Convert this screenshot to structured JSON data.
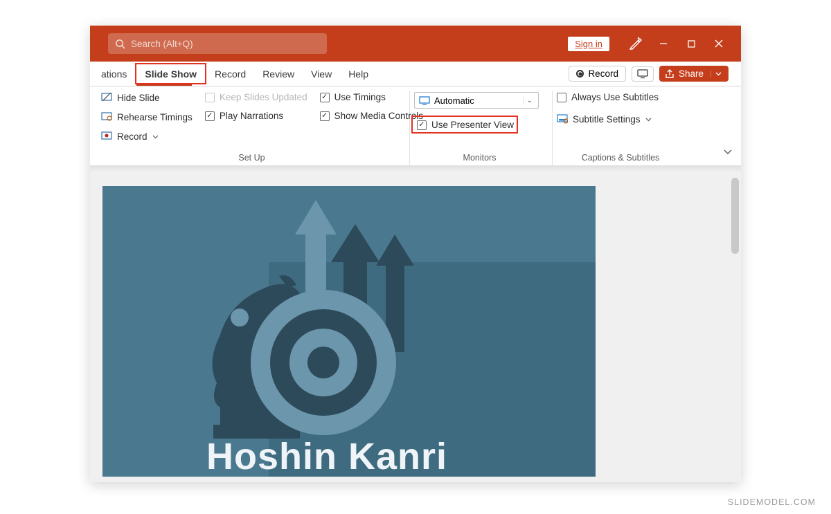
{
  "titlebar": {
    "search_placeholder": "Search (Alt+Q)",
    "signin_label": "Sign in"
  },
  "tabs": {
    "partial": "ations",
    "slide_show": "Slide Show",
    "record": "Record",
    "review": "Review",
    "view": "View",
    "help": "Help",
    "record_btn": "Record",
    "share_btn": "Share"
  },
  "ribbon": {
    "setup": {
      "hide_slide": "Hide Slide",
      "rehearse": "Rehearse Timings",
      "record": "Record",
      "keep_updated": "Keep Slides Updated",
      "play_narrations": "Play Narrations",
      "use_timings": "Use Timings",
      "show_media": "Show Media Controls",
      "label": "Set Up"
    },
    "monitors": {
      "auto": "Automatic",
      "presenter": "Use Presenter View",
      "label": "Monitors"
    },
    "captions": {
      "always": "Always Use Subtitles",
      "settings": "Subtitle Settings",
      "label": "Captions & Subtitles"
    }
  },
  "slide": {
    "title_part": "Hoshin Kanri"
  },
  "watermark": "SLIDEMODEL.COM"
}
